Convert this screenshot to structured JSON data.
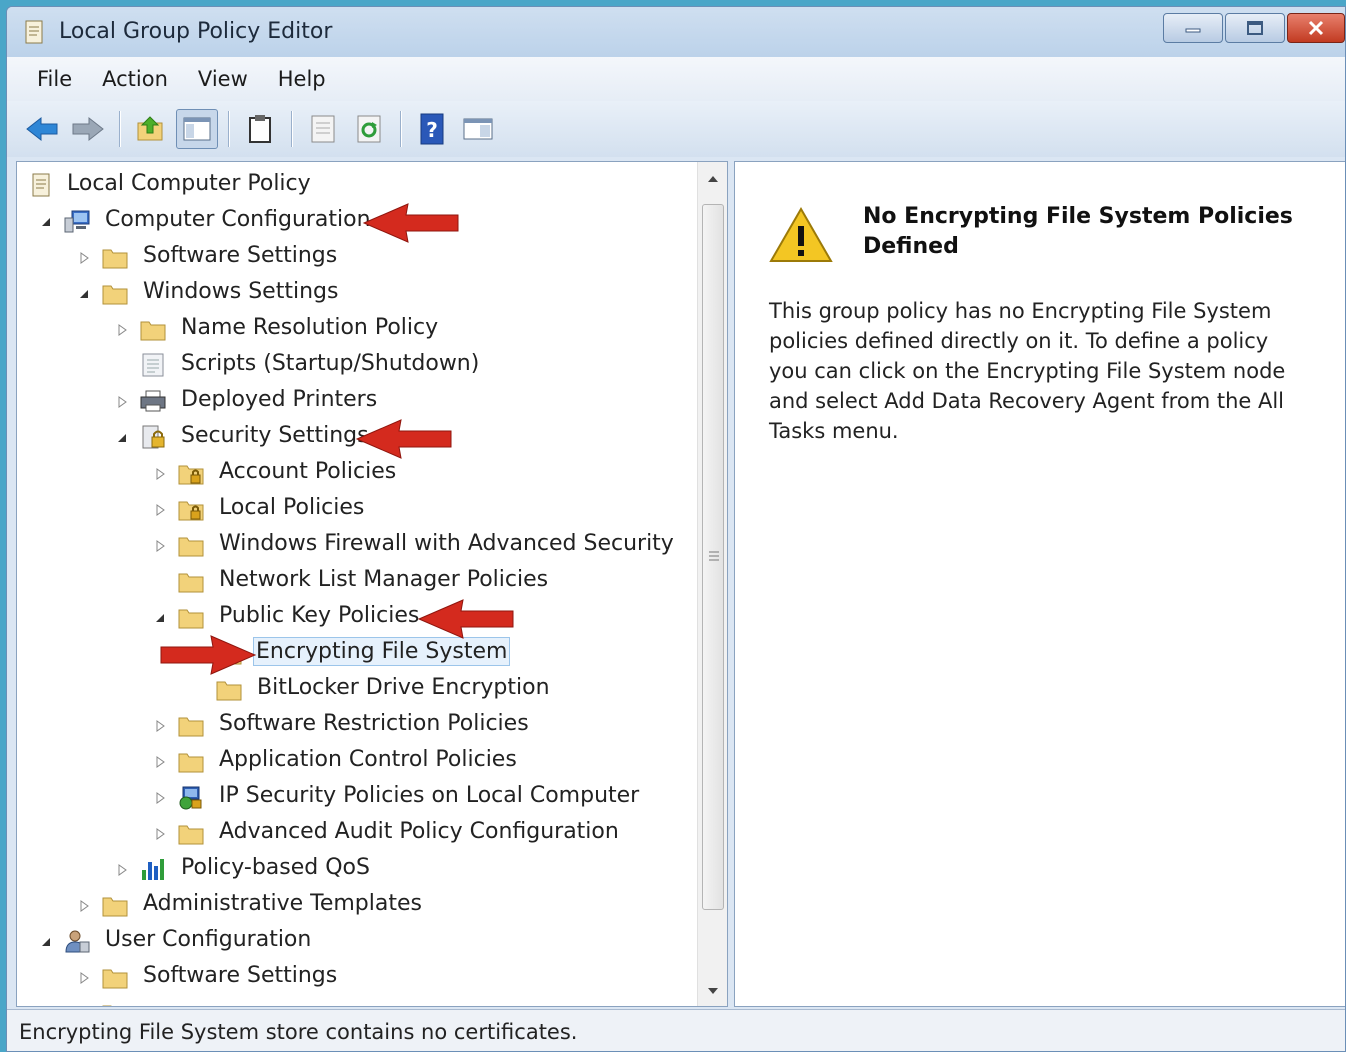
{
  "window": {
    "title": "Local Group Policy Editor"
  },
  "menu": [
    "File",
    "Action",
    "View",
    "Help"
  ],
  "toolbar_icons": [
    "back-icon",
    "forward-icon",
    "up-folder-icon",
    "show-hide-tree-icon",
    "clipboard-icon",
    "properties-icon",
    "refresh-icon",
    "help-icon",
    "console-view-icon"
  ],
  "tree": {
    "root": "Local Computer Policy",
    "computer_configuration": "Computer Configuration",
    "software_settings": "Software Settings",
    "windows_settings": "Windows Settings",
    "name_resolution_policy": "Name Resolution Policy",
    "scripts": "Scripts (Startup/Shutdown)",
    "deployed_printers": "Deployed Printers",
    "security_settings": "Security Settings",
    "account_policies": "Account Policies",
    "local_policies": "Local Policies",
    "windows_firewall": "Windows Firewall with Advanced Security",
    "network_list_manager": "Network List Manager Policies",
    "public_key_policies": "Public Key Policies",
    "encrypting_file_system": "Encrypting File System",
    "bitlocker": "BitLocker Drive Encryption",
    "software_restriction": "Software Restriction Policies",
    "application_control": "Application Control Policies",
    "ip_security": "IP Security Policies on Local Computer",
    "advanced_audit": "Advanced Audit Policy Configuration",
    "policy_based_qos": "Policy-based QoS",
    "administrative_templates": "Administrative Templates",
    "user_configuration": "User Configuration",
    "user_software_settings": "Software Settings"
  },
  "detail": {
    "title": "No Encrypting File System Policies Defined",
    "body": "This group policy has no Encrypting File System policies defined directly on it.  To define a policy you can click on the Encrypting File System node and select Add Data Recovery Agent from the All Tasks menu."
  },
  "status": "Encrypting File System store contains no certificates.",
  "colors": {
    "annotation_arrow": "#d42a1e",
    "folder": "#f2d27a",
    "selection": "#e6f1fc"
  }
}
